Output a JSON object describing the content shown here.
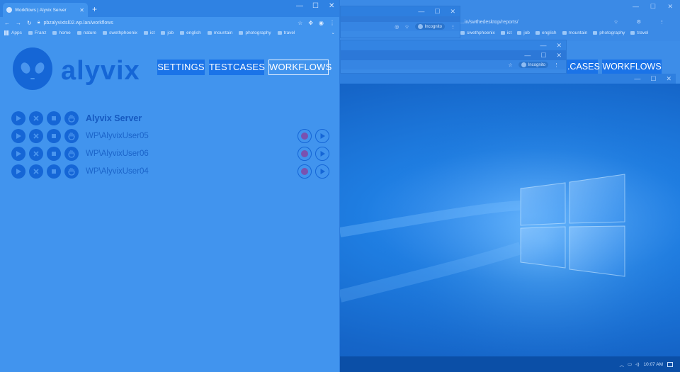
{
  "background_window": {
    "url_text": "...in/swthedesktop/reports/",
    "incognito_label": "Incognito",
    "bookmarks": [
      "swethphoenix",
      "ict",
      "job",
      "english",
      "mountain",
      "photography",
      "travel"
    ],
    "nav_buttons": [
      "...CASES",
      "WORKFLOWS"
    ],
    "taskbar_time": "10:07 AM"
  },
  "browser": {
    "tab_title": "Workflows | Alyvix Server",
    "url": "pbzalyvixtsl02.wp.lan/workflows",
    "bookmarks": [
      "Apps",
      "Franz",
      "home",
      "nature",
      "swethphoenix",
      "ict",
      "job",
      "english",
      "mountain",
      "photography",
      "travel"
    ]
  },
  "app": {
    "logo_text": "alyvix",
    "nav": {
      "settings": "SETTINGS",
      "testcases": "TESTCASES",
      "workflows": "WORKFLOWS"
    },
    "workflows": [
      {
        "label": "Alyvix Server",
        "is_server": true
      },
      {
        "label": "WP\\AlyvixUser05",
        "is_server": false
      },
      {
        "label": "WP\\AlyvixUser06",
        "is_server": false
      },
      {
        "label": "WP\\AlyvixUser04",
        "is_server": false
      }
    ]
  },
  "colors": {
    "primary": "#1a73e8",
    "overlay": "#4194ee",
    "record": "#7a52b0"
  },
  "icons": [
    "play-icon",
    "close-icon",
    "stop-icon",
    "hand-icon",
    "record-icon"
  ]
}
